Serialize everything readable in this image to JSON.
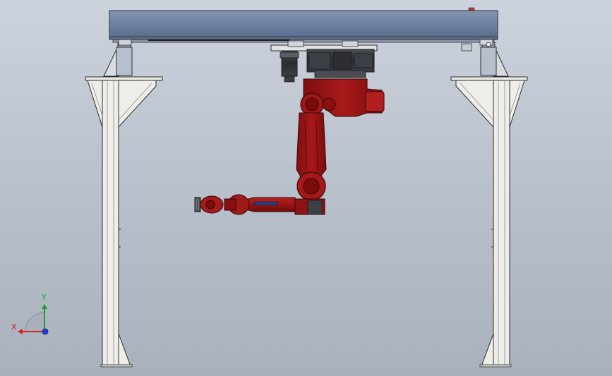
{
  "triad": {
    "x_label": "X",
    "y_label": "Y",
    "x_color": "#d42020",
    "y_color": "#17a02a",
    "z_color": "#1c3fd8"
  },
  "colors": {
    "background_top": "#cdd3dd",
    "background_bottom": "#a9b1bd",
    "gantry_beam": "#6c7d9c",
    "frame": "#eeede7",
    "robot": "#a01616"
  }
}
